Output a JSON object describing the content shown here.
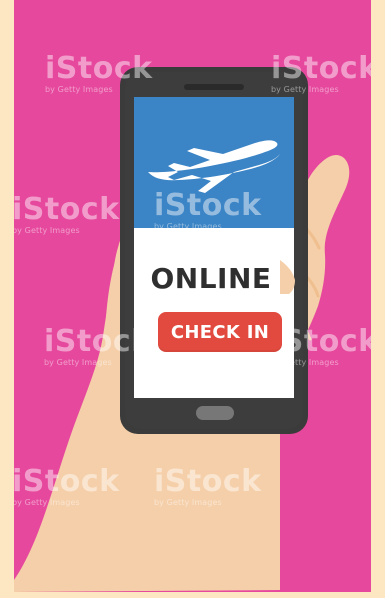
{
  "screen": {
    "title": "ONLINE",
    "button_label": "CHECK IN"
  },
  "watermarks": [
    {
      "brand": "iStock",
      "sub": "by Getty Images"
    }
  ],
  "colors": {
    "background": "#e6489d",
    "frame": "#fde7c3",
    "phone_body": "#3b3b3b",
    "screen_header": "#3b84c5",
    "button": "#e24a3f",
    "skin": "#f5cfa9"
  },
  "icons": {
    "airplane": "airplane-icon"
  }
}
